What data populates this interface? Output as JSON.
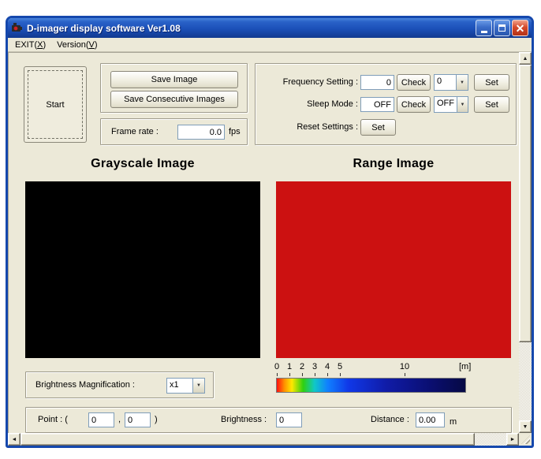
{
  "window": {
    "title": "D-imager display software Ver1.08"
  },
  "menu": {
    "exit_pre": "EXIT(",
    "exit_key": "X",
    "exit_post": ")",
    "version_pre": "Version(",
    "version_key": "V",
    "version_post": ")"
  },
  "capture": {
    "start": "Start",
    "save_image": "Save Image",
    "save_consecutive": "Save Consecutive Images",
    "frame_rate_label": "Frame rate :",
    "frame_rate_value": "0.0",
    "frame_rate_unit": "fps"
  },
  "device_settings": {
    "frequency": {
      "label": "Frequency Setting :",
      "value": "0",
      "check": "Check",
      "select_value": "0",
      "set": "Set"
    },
    "sleep": {
      "label": "Sleep Mode :",
      "value": "OFF",
      "check": "Check",
      "select_value": "OFF",
      "set": "Set"
    },
    "reset": {
      "label": "Reset Settings :",
      "set": "Set"
    }
  },
  "viewers": {
    "grayscale_title": "Grayscale Image",
    "range_title": "Range Image"
  },
  "range_scale": {
    "ticks": [
      "0",
      "1",
      "2",
      "3",
      "4",
      "5",
      "10"
    ],
    "unit": "[m]"
  },
  "magnification": {
    "label": "Brightness Magnification :",
    "value": "x1"
  },
  "status": {
    "point_label": "Point : (",
    "point_x": "0",
    "point_separator": ",",
    "point_y": "0",
    "point_close": ")",
    "brightness_label": "Brightness :",
    "brightness_value": "0",
    "distance_label": "Distance :",
    "distance_value": "0.00",
    "distance_unit": "m"
  },
  "colors": {
    "grayscale_image": "#000000",
    "range_image": "#cc1111",
    "scale_gradient": [
      "#ff1010 0%",
      "#ff9000 4%",
      "#ffe800 8%",
      "#2ed010 14%",
      "#10c8c8 20%",
      "#1080ff 27%",
      "#1038e8 38%",
      "#101ca8 58%",
      "#0a0e70 82%",
      "#060944 100%"
    ]
  }
}
